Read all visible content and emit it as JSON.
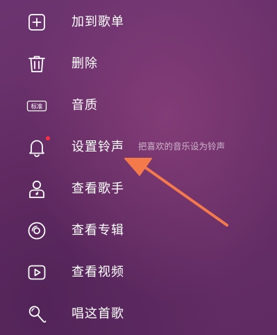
{
  "menu": {
    "items": [
      {
        "label": "加到歌单",
        "icon": "add-to-playlist-icon"
      },
      {
        "label": "删除",
        "icon": "trash-icon"
      },
      {
        "label": "音质",
        "icon": "sound-quality-badge-icon",
        "badge_text": "标准"
      },
      {
        "label": "设置铃声",
        "icon": "bell-icon",
        "hint": "把喜欢的音乐设为铃声",
        "has_red_dot": true
      },
      {
        "label": "查看歌手",
        "icon": "singer-icon"
      },
      {
        "label": "查看专辑",
        "icon": "album-disc-icon"
      },
      {
        "label": "查看视频",
        "icon": "video-play-icon"
      },
      {
        "label": "唱这首歌",
        "icon": "microphone-icon"
      }
    ]
  },
  "colors": {
    "background": "#6a2f68",
    "text": "#ffffff",
    "notification_dot": "#ff2d47",
    "annotation_arrow": "#f47a4c"
  }
}
